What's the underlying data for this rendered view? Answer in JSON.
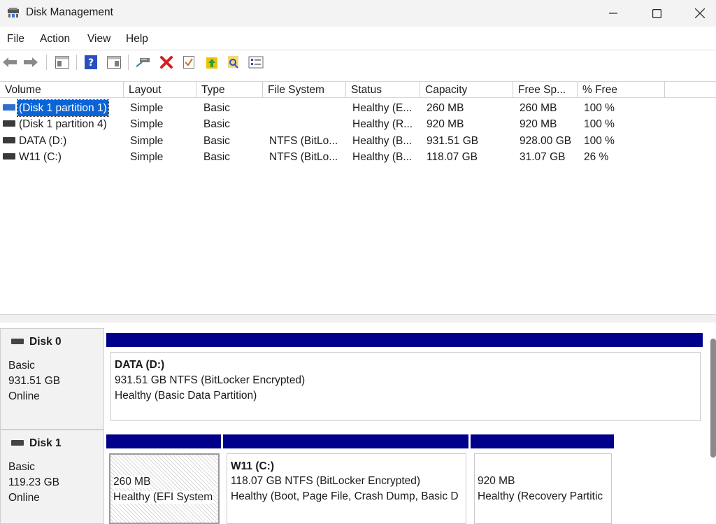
{
  "window": {
    "title": "Disk Management",
    "min_glyph": "—",
    "max_glyph": "☐",
    "close_glyph": "✕"
  },
  "menu": [
    "File",
    "Action",
    "View",
    "Help"
  ],
  "toolbar": {
    "icons": [
      "back-icon",
      "forward-icon",
      "console-tree-icon",
      "help-icon",
      "show-hide-action-pane-icon",
      "connect-drive-icon",
      "delete-icon",
      "properties-icon",
      "export-icon",
      "find-icon",
      "settings-icon"
    ],
    "colors": {
      "delete": "#d81e1e",
      "help": "#2a4fc0",
      "export": "#f2c200"
    }
  },
  "columns": [
    "Volume",
    "Layout",
    "Type",
    "File System",
    "Status",
    "Capacity",
    "Free Sp...",
    "% Free"
  ],
  "volumes": [
    {
      "name": "(Disk 1 partition 1)",
      "layout": "Simple",
      "type": "Basic",
      "fs": "",
      "status": "Healthy (E...",
      "capacity": "260 MB",
      "free": "260 MB",
      "pct": "100 %",
      "icon": "blue-volume-icon",
      "selected": true
    },
    {
      "name": "(Disk 1 partition 4)",
      "layout": "Simple",
      "type": "Basic",
      "fs": "",
      "status": "Healthy (R...",
      "capacity": "920 MB",
      "free": "920 MB",
      "pct": "100 %",
      "icon": "volume-icon",
      "selected": false
    },
    {
      "name": "DATA (D:)",
      "layout": "Simple",
      "type": "Basic",
      "fs": "NTFS (BitLo...",
      "status": "Healthy (B...",
      "capacity": "931.51 GB",
      "free": "928.00 GB",
      "pct": "100 %",
      "icon": "volume-icon",
      "selected": false
    },
    {
      "name": "W11 (C:)",
      "layout": "Simple",
      "type": "Basic",
      "fs": "NTFS (BitLo...",
      "status": "Healthy (B...",
      "capacity": "118.07 GB",
      "free": "31.07 GB",
      "pct": "26 %",
      "icon": "volume-icon",
      "selected": false
    }
  ],
  "disks": [
    {
      "name": "Disk 0",
      "kind": "Basic",
      "size": "931.51 GB",
      "state": "Online",
      "partitions": [
        {
          "title": "DATA  (D:)",
          "line1": "931.51 GB NTFS (BitLocker Encrypted)",
          "line2": "Healthy (Basic Data Partition)"
        }
      ]
    },
    {
      "name": "Disk 1",
      "kind": "Basic",
      "size": "119.23 GB",
      "state": "Online",
      "partitions": [
        {
          "title": "",
          "line1": "260 MB",
          "line2": "Healthy (EFI System",
          "selected": true
        },
        {
          "title": "W11  (C:)",
          "line1": "118.07 GB NTFS (BitLocker Encrypted)",
          "line2": "Healthy (Boot, Page File, Crash Dump, Basic D"
        },
        {
          "title": "",
          "line1": "920 MB",
          "line2": "Healthy (Recovery Partitic"
        }
      ]
    }
  ],
  "colors": {
    "partition_bar": "#00008b",
    "selection": "#0a64d6",
    "volume_icon_blue": "#2f6fd0"
  }
}
